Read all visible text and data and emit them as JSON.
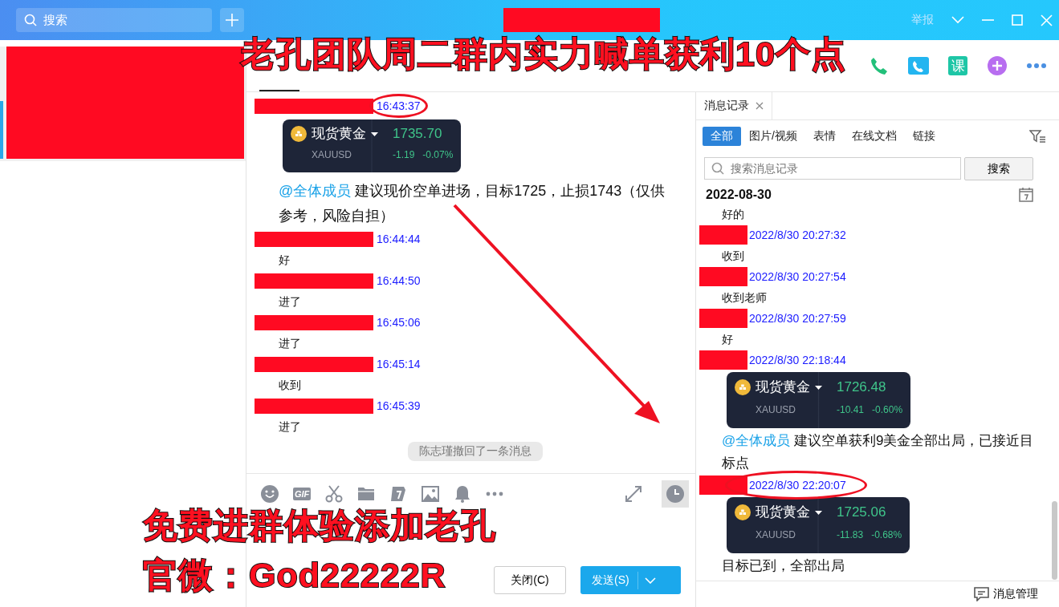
{
  "window": {
    "search_placeholder": "搜索",
    "report": "举报"
  },
  "overlay_texts": [
    "老孔团队周二群内实力喊单获利10个点",
    "免费进群体验添加老孔",
    "官微：God22222R"
  ],
  "header_icons": [
    {
      "kind": "phone"
    },
    {
      "kind": "video"
    },
    {
      "kind": "text",
      "label": "课"
    },
    {
      "kind": "add"
    },
    {
      "kind": "more"
    }
  ],
  "chat": {
    "messages": [
      {
        "kind": "message",
        "time": "16:43:37",
        "circled": true,
        "quote": {
          "name": "现货黄金",
          "symbol": "XAUUSD",
          "price": "1735.70",
          "change": "-1.19",
          "percent": "-0.07%"
        },
        "mention": "@全体成员",
        "text": "建议现价空单进场，目标1725，止损1743（仅供参考，风险自担）"
      },
      {
        "kind": "message",
        "time": "16:44:44",
        "circled": false,
        "text": "好"
      },
      {
        "kind": "message",
        "time": "16:44:50",
        "circled": false,
        "text": "进了"
      },
      {
        "kind": "message",
        "time": "16:45:06",
        "circled": false,
        "text": "进了"
      },
      {
        "kind": "message",
        "time": "16:45:14",
        "circled": false,
        "text": "收到"
      },
      {
        "kind": "message",
        "time": "16:45:39",
        "circled": false,
        "text": "进了"
      },
      {
        "kind": "notice",
        "text": "陈志瑾撤回了一条消息"
      }
    ]
  },
  "toolbar": {
    "gif_label": "GIF"
  },
  "buttons": [
    {
      "kind": "secondary",
      "label": "关闭(C)"
    },
    {
      "kind": "primary",
      "label": "发送(S)"
    }
  ],
  "history": {
    "tab": "消息记录",
    "filters": [
      {
        "label": "全部",
        "selected": true
      },
      {
        "label": "图片/视频",
        "selected": false
      },
      {
        "label": "表情",
        "selected": false
      },
      {
        "label": "在线文档",
        "selected": false
      },
      {
        "label": "链接",
        "selected": false
      }
    ],
    "search_placeholder": "搜索消息记录",
    "search_button": "搜索",
    "date": "2022-08-30",
    "records": [
      {
        "text": "好的"
      },
      {
        "time": "2022/8/30 20:27:32",
        "circled": false,
        "text": "收到"
      },
      {
        "time": "2022/8/30 20:27:54",
        "circled": false,
        "text": "收到老师"
      },
      {
        "time": "2022/8/30 20:27:59",
        "circled": false,
        "text": "好"
      },
      {
        "time": "2022/8/30 22:18:44",
        "circled": false,
        "quote": {
          "name": "现货黄金",
          "symbol": "XAUUSD",
          "price": "1726.48",
          "change": "-10.41",
          "percent": "-0.60%"
        },
        "mention": "@全体成员",
        "text": "建议空单获利9美金全部出局，已接近目标点"
      },
      {
        "time": "2022/8/30 22:20:07",
        "circled": true,
        "quote": {
          "name": "现货黄金",
          "symbol": "XAUUSD",
          "price": "1725.06",
          "change": "-11.83",
          "percent": "-0.68%"
        },
        "text": "目标已到，全部出局"
      }
    ],
    "footer": "消息管理"
  }
}
